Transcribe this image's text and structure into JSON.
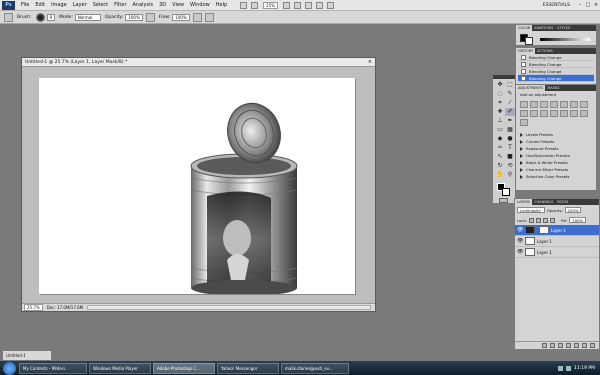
{
  "menubar": {
    "logo": "Ps",
    "items": [
      "File",
      "Edit",
      "Image",
      "Layer",
      "Select",
      "Filter",
      "Analysis",
      "3D",
      "View",
      "Window",
      "Help"
    ],
    "zoom": "25%",
    "workspace": "ESSENTIALS",
    "controls": {
      "minimize": "–",
      "restore": "□",
      "close": "×"
    }
  },
  "options": {
    "brush_label": "Brush:",
    "brush_size": "9",
    "mode_label": "Mode:",
    "mode_value": "Normal",
    "opacity_label": "Opacity:",
    "opacity_value": "100%",
    "flow_label": "Flow:",
    "flow_value": "100%"
  },
  "document": {
    "title": "Untitled-1 @ 25.7% (Layer 1, Layer Mask/8) *",
    "close": "×",
    "status_zoom": "25.7%",
    "status_doc": "Doc: 17.0M/17.6M"
  },
  "colorpanel": {
    "tabs": [
      "COLOR",
      "SWATCHES",
      "STYLES"
    ]
  },
  "history": {
    "tabs": [
      "HISTORY",
      "ACTIONS"
    ],
    "rows": [
      "Blending Change",
      "Blending Change",
      "Blending Change",
      "Blending Change"
    ]
  },
  "adjustments": {
    "tabs": [
      "ADJUSTMENTS",
      "MASKS"
    ],
    "add_label": "Add an adjustment",
    "presets": [
      "Levels Presets",
      "Curves Presets",
      "Exposure Presets",
      "Hue/Saturation Presets",
      "Black & White Presets",
      "Channel Mixer Presets",
      "Selective Color Presets"
    ]
  },
  "layers": {
    "tabs": [
      "LAYERS",
      "CHANNELS",
      "PATHS"
    ],
    "blend_mode": "Luminosity",
    "opacity_label": "Opacity:",
    "opacity_value": "100%",
    "lock_label": "Lock:",
    "fill_label": "Fill:",
    "fill_value": "100%",
    "items": [
      {
        "name": "Layer 1",
        "active": true
      },
      {
        "name": "Layer 1",
        "active": false
      },
      {
        "name": "Layer 1",
        "active": false
      }
    ]
  },
  "minidoc": {
    "title": "Untitled-1"
  },
  "taskbar": {
    "items": [
      {
        "label": "My Contests - 99desi...",
        "active": false
      },
      {
        "label": "Windows Media Player",
        "active": false
      },
      {
        "label": "Adobe Photoshop C...",
        "active": true
      },
      {
        "label": "Yahoo! Messenger",
        "active": false
      },
      {
        "label": "malik.diaries@outl_ev...",
        "active": false
      }
    ],
    "time": "11:19 PM"
  },
  "colors": {
    "accent_selection": "#3a6fd1",
    "workspace_bg": "#7a7a7a",
    "panel_bg": "#d4d4d4"
  }
}
